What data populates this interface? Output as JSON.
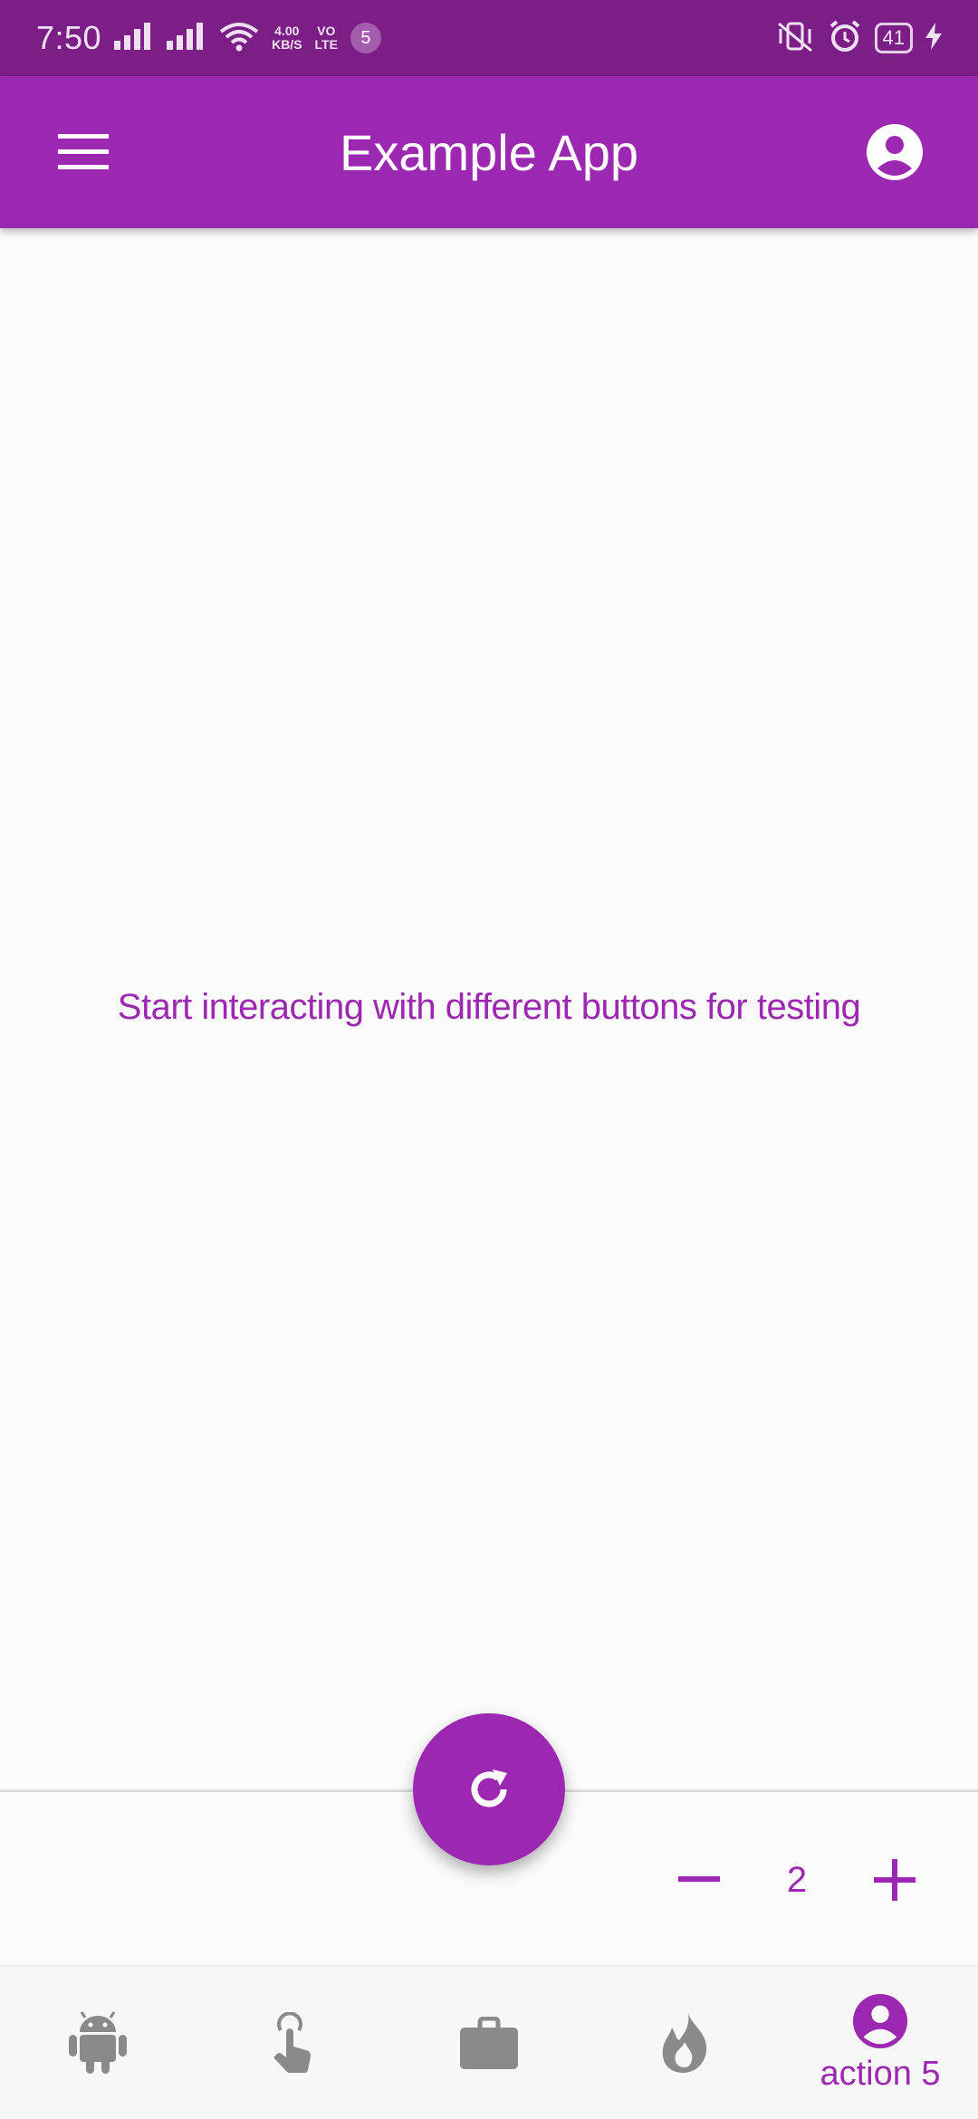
{
  "status_bar": {
    "time": "7:50",
    "net_speed_top": "4.00",
    "net_speed_bottom": "KB/S",
    "volte_top": "VO",
    "volte_bottom": "LTE",
    "notification_count": "5",
    "battery": "41"
  },
  "app_bar": {
    "title": "Example App"
  },
  "main": {
    "message": "Start interacting with different buttons for testing"
  },
  "stepper": {
    "value": "2"
  },
  "bottom_nav": {
    "items": [
      {
        "icon": "android-icon",
        "label": ""
      },
      {
        "icon": "touch-icon",
        "label": ""
      },
      {
        "icon": "briefcase-icon",
        "label": ""
      },
      {
        "icon": "fire-icon",
        "label": ""
      },
      {
        "icon": "account-circle-icon",
        "label": "action 5"
      }
    ]
  },
  "colors": {
    "primary": "#9c27b0",
    "status_bar": "#7b1f86",
    "inactive_icon": "#8a8a8a",
    "background": "#fafafa"
  }
}
